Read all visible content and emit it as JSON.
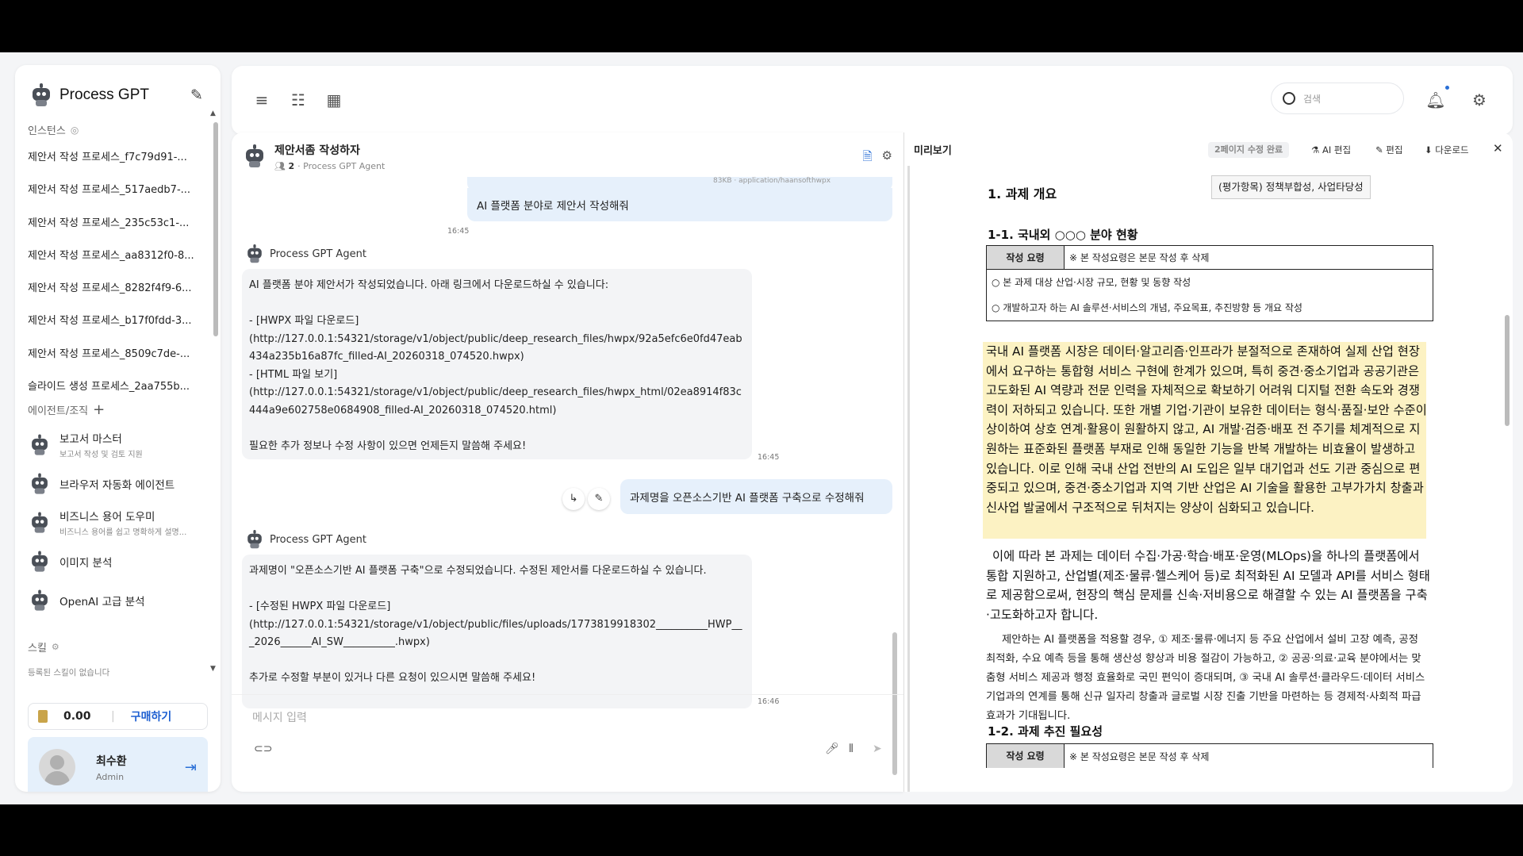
{
  "sidebar": {
    "app_title": "Process GPT",
    "instances_title": "인스턴스",
    "instances": [
      "제안서 작성 프로세스_f7c79d91-...",
      "제안서 작성 프로세스_517aedb7-...",
      "제안서 작성 프로세스_235c53c1-...",
      "제안서 작성 프로세스_aa8312f0-8...",
      "제안서 작성 프로세스_8282f4f9-6...",
      "제안서 작성 프로세스_b17f0fdd-3...",
      "제안서 작성 프로세스_8509c7de-...",
      "슬라이드 생성 프로세스_2aa755b..."
    ],
    "agents_title": "에이전트/조직",
    "agents": [
      {
        "name": "보고서 마스터",
        "desc": "보고서 작성 및 검토 지원"
      },
      {
        "name": "브라우저 자동화 에이전트",
        "desc": ""
      },
      {
        "name": "비즈니스 용어 도우미",
        "desc": "비즈니스 용어를 쉽고 명확하게 설명..."
      },
      {
        "name": "이미지 분석",
        "desc": ""
      },
      {
        "name": "OpenAI 고급 분석",
        "desc": ""
      }
    ],
    "skills_title": "스킬",
    "skills_empty": "등록된 스킬이 없습니다",
    "credits": "0.00",
    "buy_label": "구매하기",
    "user_name": "최수환",
    "user_role": "Admin"
  },
  "topbar": {
    "search_placeholder": "검색"
  },
  "chat": {
    "title": "제안서좀 작성하자",
    "participants": "2",
    "subtitle": "Process GPT Agent",
    "attachment_meta": "83KB · application/haansofthwpx",
    "messages": [
      {
        "role": "user",
        "text": "AI 플랫폼 분야로 제안서 작성해줘",
        "time": "16:45"
      },
      {
        "role": "agent",
        "sender": "Process GPT Agent",
        "text": "AI 플랫폼 분야 제안서가 작성되었습니다. 아래 링크에서 다운로드하실 수 있습니다:\n\n- [HWPX 파일 다운로드]\n(http://127.0.0.1:54321/storage/v1/object/public/deep_research_files/hwpx/92a5efc6e0fd47eab434a235b16a87fc_filled-AI_20260318_074520.hwpx)\n- [HTML 파일 보기]\n(http://127.0.0.1:54321/storage/v1/object/public/deep_research_files/hwpx_html/02ea8914f83c444a9e602758e0684908_filled-AI_20260318_074520.html)\n\n필요한 추가 정보나 수정 사항이 있으면 언제든지 말씀해 주세요!",
        "time": "16:45"
      },
      {
        "role": "user",
        "text": "과제명을 오픈소스기반 AI 플랫폼 구축으로 수정해줘",
        "time": ""
      },
      {
        "role": "agent",
        "sender": "Process GPT Agent",
        "text": "과제명이 \"오픈소스기반 AI 플랫폼 구축\"으로 수정되었습니다. 수정된 제안서를 다운로드하실 수 있습니다.\n\n- [수정된 HWPX 파일 다운로드]\n(http://127.0.0.1:54321/storage/v1/object/public/files/uploads/1773819918302__________HWP___2026______AI_SW__________.hwpx)\n\n추가로 수정할 부분이 있거나 다른 요청이 있으시면 말씀해 주세요!",
        "time": "16:46"
      }
    ],
    "input_placeholder": "메시지 입력"
  },
  "preview": {
    "title": "미리보기",
    "badge": "2페이지 수정 완료",
    "ai_edit": "AI 편집",
    "edit": "편집",
    "download": "다운로드",
    "doc": {
      "h1": "1. 과제 개요",
      "criteria": "(평가항목)   정책부합성, 사업타당성",
      "h2_1": "1-1. 국내외 ○○○ 분야 현황",
      "guide_label": "작성 요령",
      "guide_text": "※ 본 작성요령은 본문 작성 후 삭제",
      "bullet1": "○  본 과제 대상 산업·시장 규모, 현황 및 동향 작성",
      "bullet2": "○  개발하고자 하는 AI 솔루션·서비스의 개념, 주요목표, 추진방향 등 개요 작성",
      "highlight": "국내 AI 플랫폼 시장은 데이터·알고리즘·인프라가 분절적으로 존재하여 실제 산업 현장에서 요구하는 통합형 서비스 구현에 한계가 있으며, 특히 중견·중소기업과 공공기관은 고도화된 AI 역량과 전문 인력을 자체적으로 확보하기 어려워 디지털 전환 속도와 경쟁력이 저하되고 있습니다. 또한 개별 기업·기관이 보유한 데이터는 형식·품질·보안 수준이 상이하여 상호 연계·활용이 원활하지 않고, AI 개발·검증·배포 전 주기를 체계적으로 지원하는 표준화된 플랫폼 부재로 인해 동일한 기능을 반복 개발하는 비효율이 발생하고 있습니다. 이로 인해 국내 산업 전반의 AI 도입은 일부 대기업과 선도 기관 중심으로 편중되고 있으며, 중견·중소기업과 지역 기반 산업은 AI 기술을 활용한 고부가가치 창출과 신사업 발굴에서 구조적으로 뒤처지는 양상이 심화되고 있습니다.",
      "para1": "이에 따라 본 과제는 데이터 수집·가공·학습·배포·운영(MLOps)을 하나의 플랫폼에서 통합 지원하고, 산업별(제조·물류·헬스케어 등)로 최적화된 AI 모델과 API를 서비스 형태로 제공함으로써, 현장의 핵심 문제를 신속·저비용으로 해결할 수 있는 AI 플랫폼을 구축·고도화하고자 합니다.",
      "para2": "제안하는 AI 플랫폼을 적용할 경우, ① 제조·물류·에너지 등 주요 산업에서 설비 고장 예측, 공정 최적화, 수요 예측 등을 통해 생산성 향상과 비용 절감이 가능하고, ② 공공·의료·교육 분야에서는 맞춤형 서비스 제공과 행정 효율화로 국민 편익이 증대되며, ③ 국내 AI 솔루션·클라우드·데이터 서비스 기업과의 연계를 통해 신규 일자리 창출과 글로벌 시장 진출 기반을 마련하는 등 경제적·사회적 파급효과가 기대됩니다.",
      "h2_2": "1-2. 과제 추진 필요성"
    }
  }
}
